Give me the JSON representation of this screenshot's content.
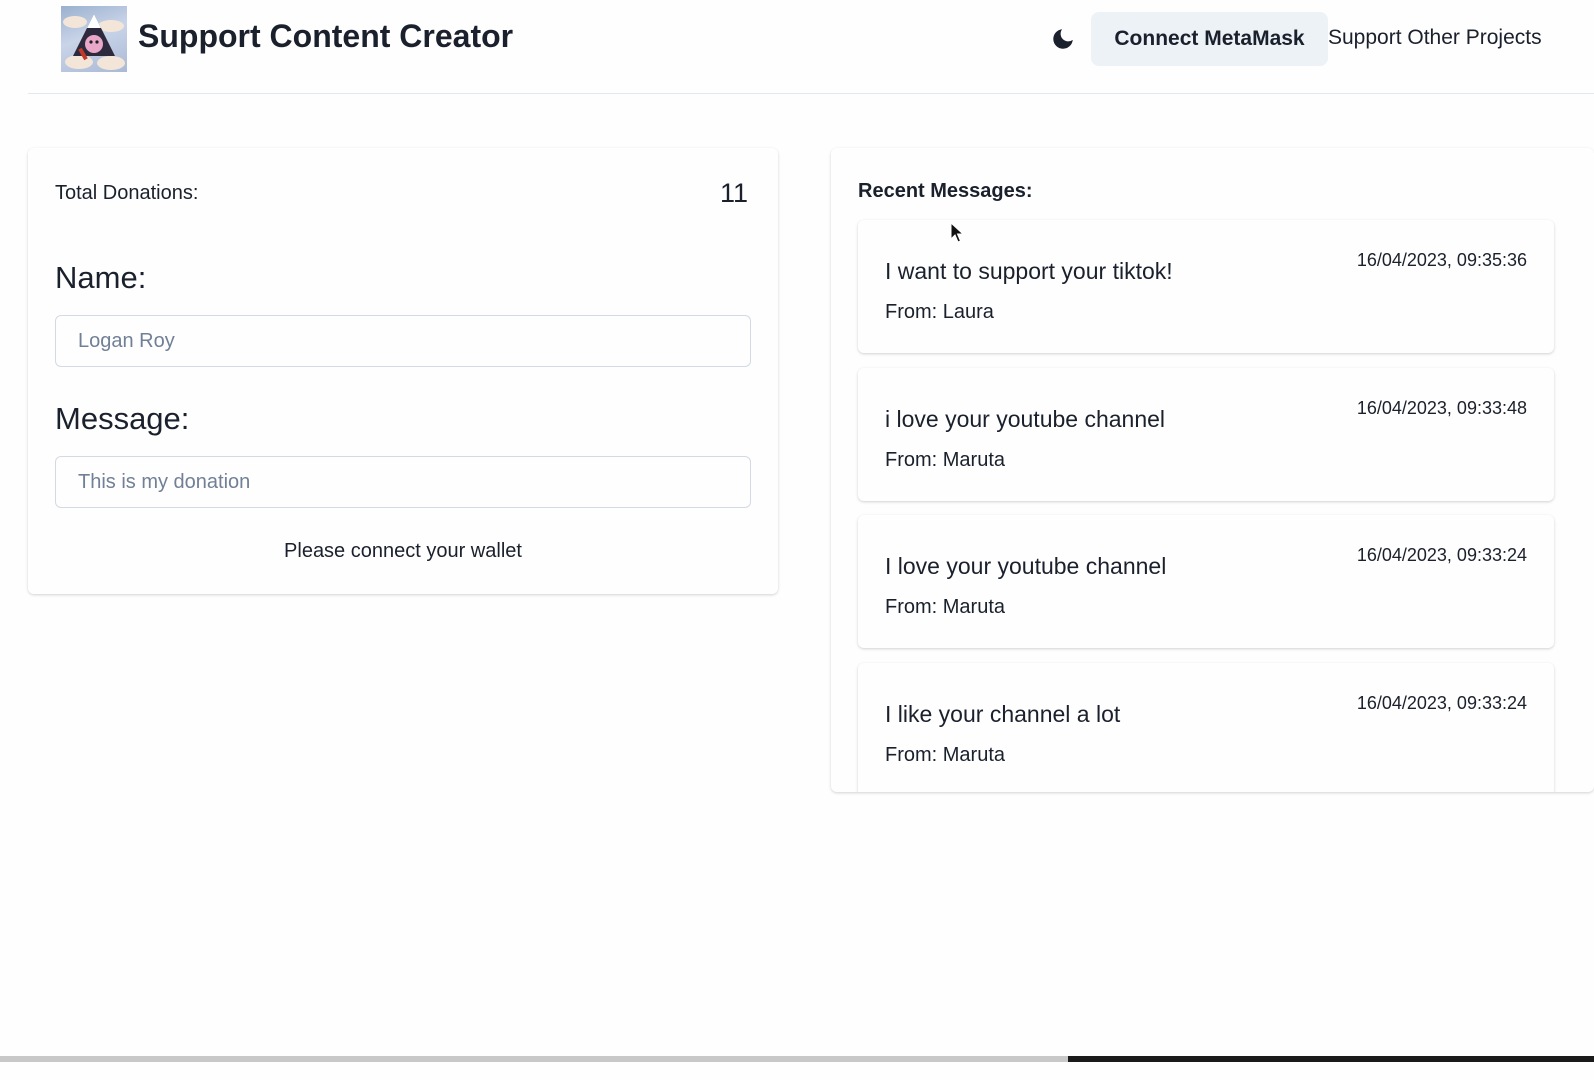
{
  "header": {
    "title": "Support Content Creator",
    "theme_icon": "moon-icon",
    "connect_label": "Connect MetaMask",
    "other_projects_label": "Support Other Projects"
  },
  "donation_form": {
    "total_label": "Total Donations:",
    "total_value": "11",
    "name_label": "Name:",
    "name_placeholder": "Logan Roy",
    "message_label": "Message:",
    "message_placeholder": "This is my donation",
    "status_text": "Please connect your wallet"
  },
  "recent": {
    "title": "Recent Messages:",
    "messages": [
      {
        "text": "I want to support your tiktok!",
        "from": "From: Laura",
        "time": "16/04/2023, 09:35:36"
      },
      {
        "text": "i love your youtube channel",
        "from": "From: Maruta",
        "time": "16/04/2023, 09:33:48"
      },
      {
        "text": "I love your youtube channel",
        "from": "From: Maruta",
        "time": "16/04/2023, 09:33:24"
      },
      {
        "text": "I like your channel a lot",
        "from": "From: Maruta",
        "time": "16/04/2023, 09:33:24"
      }
    ]
  },
  "colors": {
    "text": "#1a202c",
    "button_bg": "#edf2f7",
    "placeholder": "#718096",
    "border": "#e2e8f0"
  }
}
